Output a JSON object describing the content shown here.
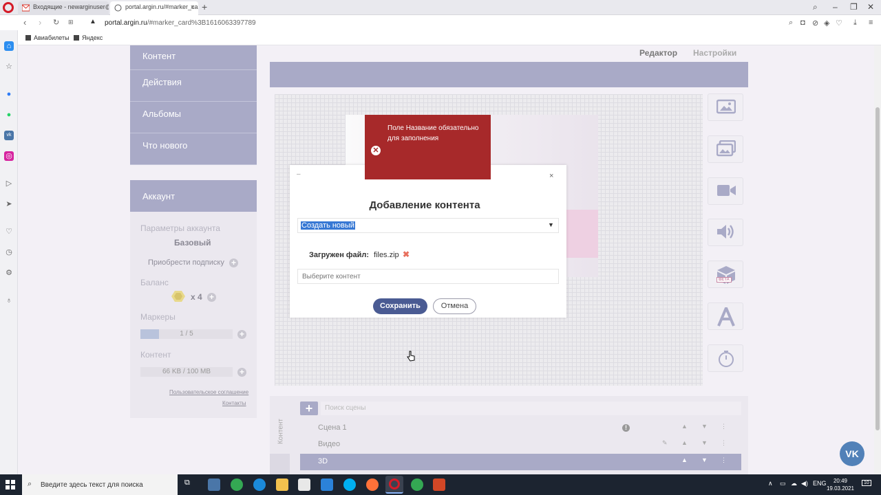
{
  "browser": {
    "tabs": [
      {
        "label": "Входящие - newarginuser@"
      },
      {
        "label": "portal.argin.ru/#marker_ca"
      }
    ],
    "url_domain": "portal.argin.ru",
    "url_path": "/#marker_card%3B1616063397789",
    "bookmarks": [
      "Авиабилеты",
      "Яндекс"
    ]
  },
  "nav": {
    "items": [
      "Контент",
      "Действия",
      "Альбомы",
      "Что нового"
    ]
  },
  "account": {
    "header": "Аккаунт",
    "params_label": "Параметры аккаунта",
    "plan": "Базовый",
    "buy_subscription": "Приобрести подписку",
    "balance_label": "Баланс",
    "balance_value": "x 4",
    "markers_label": "Маркеры",
    "markers_value": "1 / 5",
    "markers_progress": 0.2,
    "content_label": "Контент",
    "content_value": "66 KB / 100 MB",
    "user_agreement": "Пользовательское соглашение",
    "contacts": "Контакты"
  },
  "editor": {
    "tab_editor": "Редактор",
    "tab_settings": "Настройки",
    "tools": [
      "image-icon",
      "gallery-icon",
      "video-icon",
      "audio-icon",
      "3d-box-icon",
      "text-icon",
      "timer-icon"
    ],
    "tool_beta_badge": "BETA"
  },
  "scenes": {
    "side_label": "Контент",
    "search_placeholder": "Поиск сцены",
    "rows": [
      {
        "label": "Сцена 1"
      },
      {
        "label": "Видео"
      },
      {
        "label": "3D"
      }
    ]
  },
  "modal": {
    "minimize": "–",
    "close": "×",
    "title": "Добавление контента",
    "select_value": "Создать новый",
    "loaded_label": "Загружен файл:",
    "loaded_file": "files.zip",
    "content_placeholder": "Выберите контент",
    "save_label": "Сохранить",
    "cancel_label": "Отмена"
  },
  "error_toast": {
    "message": "Поле Название обязательно для заполнения"
  },
  "vk_button": "VK",
  "taskbar": {
    "search_placeholder": "Введите здесь текст для поиска",
    "lang": "ENG",
    "time": "20:49",
    "date": "19.03.2021",
    "notifications": "10"
  },
  "colors": {
    "accent": "#a9aac7",
    "primary_button": "#4a5b93",
    "error": "#a7292a",
    "vk": "#5181b8"
  }
}
